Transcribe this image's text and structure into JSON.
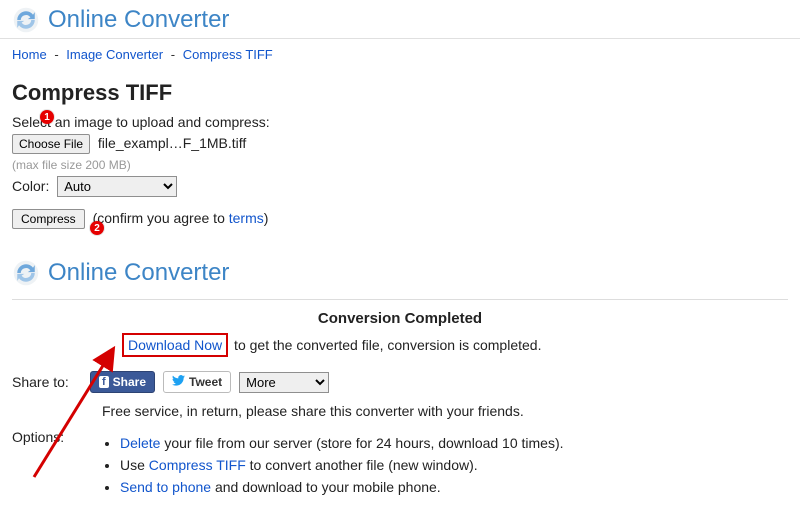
{
  "brand": "Online Converter",
  "breadcrumb": {
    "home": "Home",
    "mid": "Image Converter",
    "last": "Compress TIFF",
    "sep": "-"
  },
  "title": "Compress TIFF",
  "upload": {
    "prompt": "Select an image to upload and compress:",
    "choose": "Choose File",
    "filename": "file_exampl…F_1MB.tiff",
    "maxnote": "(max file size 200 MB)"
  },
  "color": {
    "label": "Color:",
    "selected": "Auto"
  },
  "compress": {
    "button": "Compress",
    "confirm_pre": "(confirm you agree to ",
    "terms": "terms",
    "confirm_post": ")"
  },
  "badges": {
    "one": "1",
    "two": "2"
  },
  "result": {
    "completed": "Conversion Completed",
    "download": "Download Now",
    "after": " to get the converted file, conversion is completed."
  },
  "share": {
    "label": "Share to:",
    "fb": "Share",
    "tw": "Tweet",
    "more": "More",
    "note": "Free service, in return, please share this converter with your friends."
  },
  "options": {
    "label": "Options:",
    "delete_link": "Delete",
    "delete_rest": " your file from our server (store for 24 hours, download 10 times).",
    "use_pre": "Use ",
    "use_link": "Compress TIFF",
    "use_rest": " to convert another file (new window).",
    "send_link": "Send to phone",
    "send_rest": " and download to your mobile phone."
  }
}
